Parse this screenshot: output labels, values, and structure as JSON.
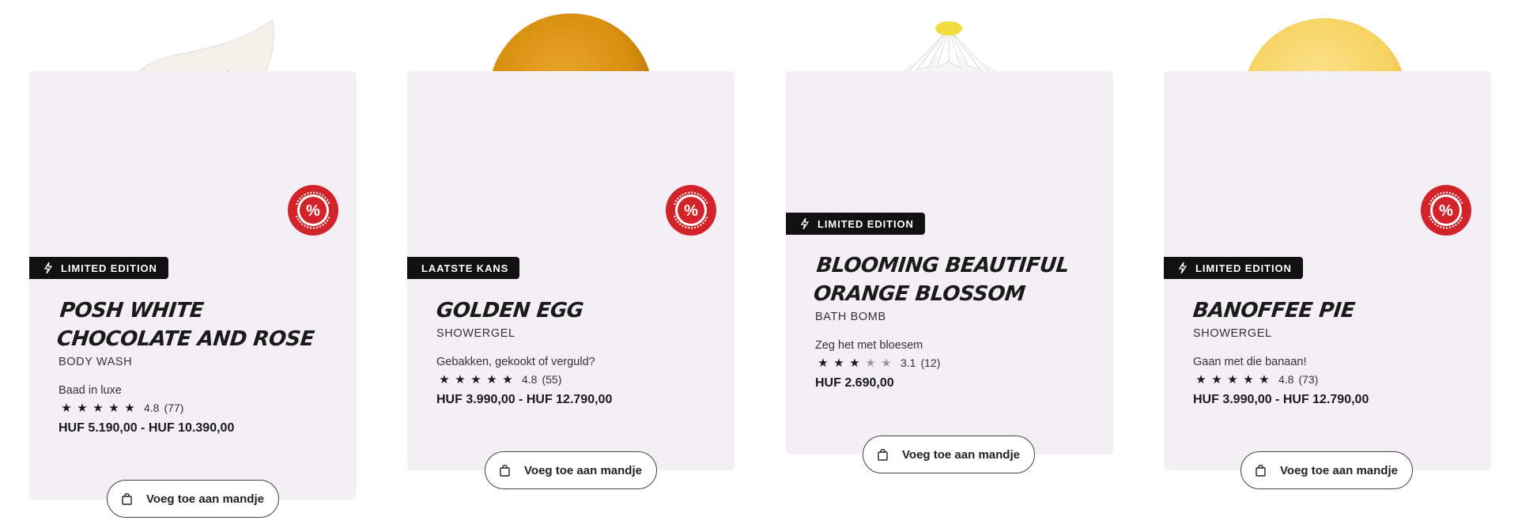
{
  "products": [
    {
      "tag": "LIMITED EDITION",
      "tag_icon": "lightning-icon",
      "title": "POSH WHITE CHOCOLATE AND ROSE",
      "category": "BODY WASH",
      "tagline": "Baad in luxe",
      "rating_score": "4.8",
      "rating_count": "(77)",
      "stars_filled": 5,
      "price": "HUF 5.190,00 - HUF 10.390,00",
      "sale_badge": true,
      "add_button_label": "Voeg toe aan mandje"
    },
    {
      "tag": "LAATSTE KANS",
      "tag_icon": "",
      "title": "GOLDEN EGG",
      "category": "SHOWERGEL",
      "tagline": "Gebakken, gekookt of verguld?",
      "rating_score": "4.8",
      "rating_count": "(55)",
      "stars_filled": 5,
      "price": "HUF 3.990,00 - HUF 12.790,00",
      "sale_badge": true,
      "add_button_label": "Voeg toe aan mandje"
    },
    {
      "tag": "LIMITED EDITION",
      "tag_icon": "lightning-icon",
      "title": "BLOOMING BEAUTIFUL ORANGE BLOSSOM",
      "category": "BATH BOMB",
      "tagline": "Zeg het met bloesem",
      "rating_score": "3.1",
      "rating_count": "(12)",
      "stars_filled": 3,
      "price": "HUF 2.690,00",
      "sale_badge": false,
      "add_button_label": "Voeg toe aan mandje"
    },
    {
      "tag": "LIMITED EDITION",
      "tag_icon": "lightning-icon",
      "title": "BANOFFEE PIE",
      "category": "SHOWERGEL",
      "tagline": "Gaan met die banaan!",
      "rating_score": "4.8",
      "rating_count": "(73)",
      "stars_filled": 5,
      "price": "HUF 3.990,00 - HUF 12.790,00",
      "sale_badge": true,
      "add_button_label": "Voeg toe aan mandje"
    }
  ],
  "sale_badge_text": "ÁR-CSÖKKENTÉS",
  "colors": {
    "card_bg": "#f3eff5",
    "tag_bg": "#111111",
    "sale_red": "#d2232a"
  }
}
